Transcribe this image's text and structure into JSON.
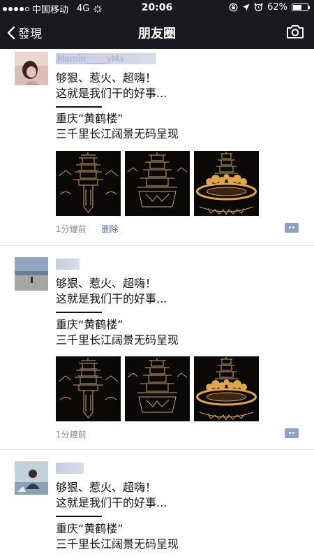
{
  "status_bar": {
    "carrier": "中国移动",
    "network": "4G",
    "time": "20:06",
    "battery": "62%",
    "battery_level": 0.62
  },
  "nav": {
    "back_label": "發現",
    "title": "朋友圈"
  },
  "posts": [
    {
      "name": "Mornin_____yMa",
      "line1": "够狠、惹火、超嗨！",
      "line2": "这就是我们干的好事...",
      "line3": "重庆“黄鹤楼”",
      "line4": "三千里长江阔景无码呈现",
      "time": "1分鐘前",
      "delete": "删除"
    },
    {
      "name": "",
      "line1": "够狠、惹火、超嗨！",
      "line2": "这就是我们干的好事...",
      "line3": "重庆“黄鹤楼”",
      "line4": "三千里长江阔景无码呈现",
      "time": "1分鐘前"
    },
    {
      "name": "",
      "line1": "够狠、惹火、超嗨！",
      "line2": "这就是我们干的好事...",
      "line3": "重庆“黄鹤楼”",
      "line4": "三千里长江阔景无码呈现"
    }
  ],
  "colors": {
    "nav_background": "#1a1a1e",
    "link": "#576b95",
    "meta_text": "#8b8b8b",
    "photo_gold": "#c9a35c",
    "photo_flame": "#e0a54a"
  }
}
